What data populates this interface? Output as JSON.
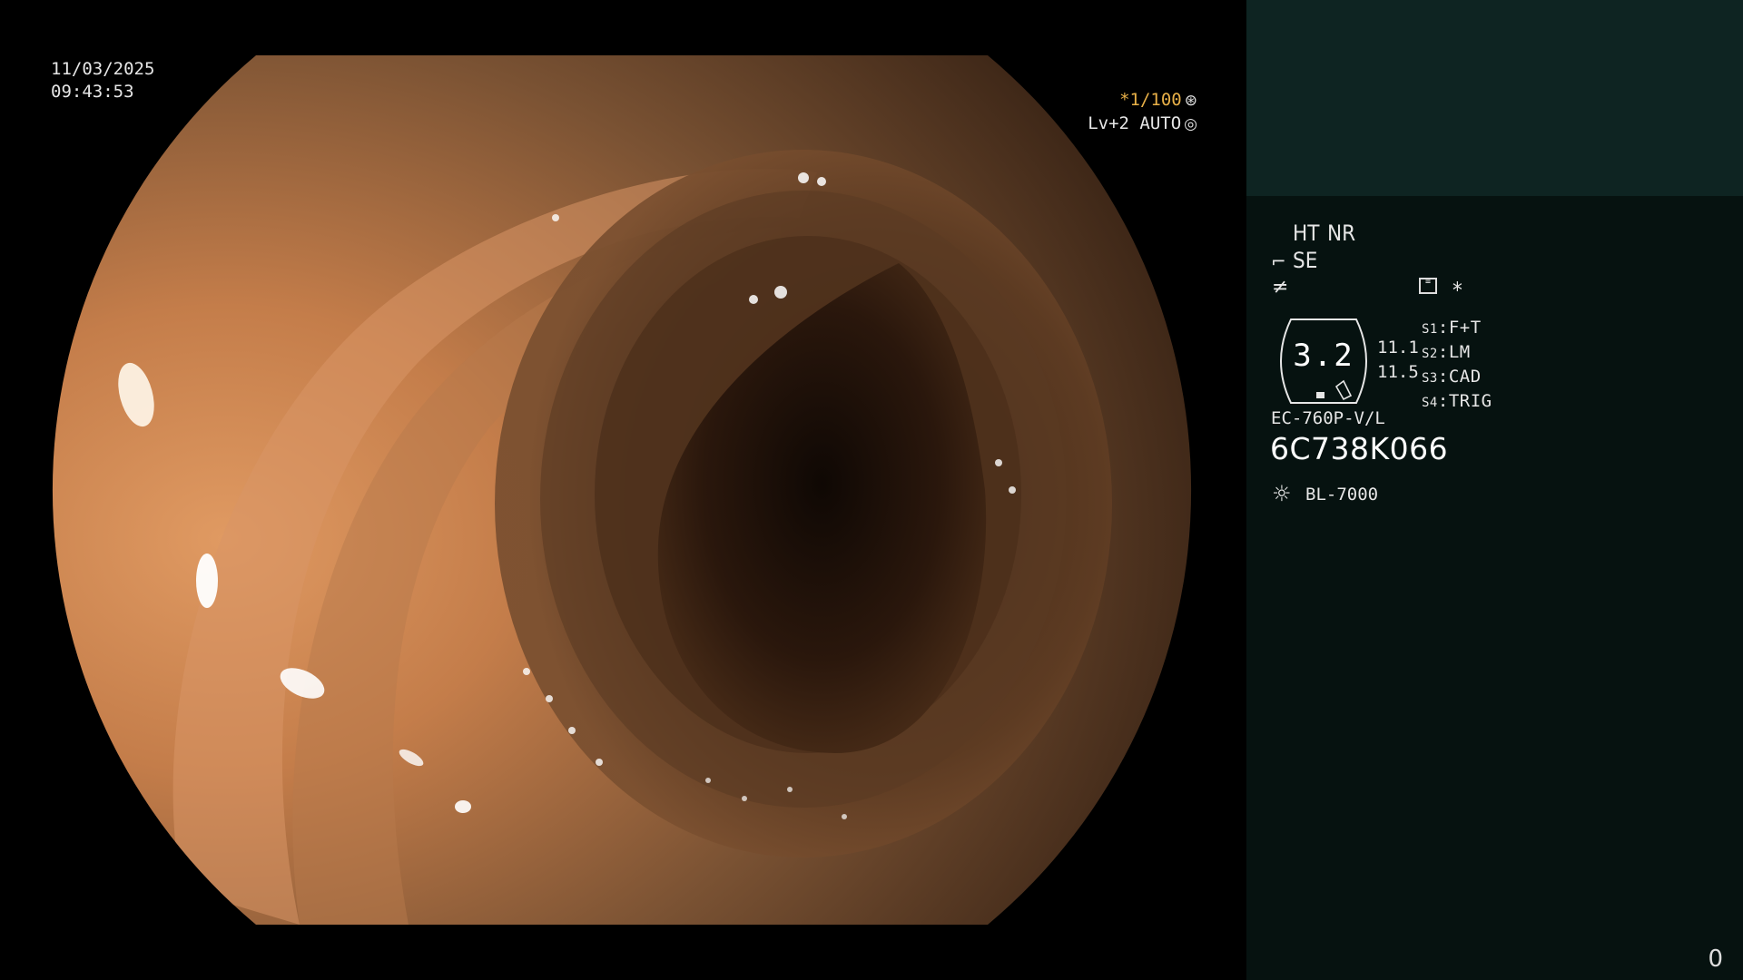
{
  "overlay": {
    "date": "11/03/2025",
    "time": "09:43:53",
    "shutter": "*1/100",
    "shutter_icon": "aperture-icon",
    "level_mode": "Lv+2 AUTO",
    "level_icon": "iris-icon"
  },
  "panel": {
    "ht_label": "HT",
    "nr_label": "NR",
    "se_label": "SE",
    "se_icon": "scope-tip-icon",
    "enhance_icon": "not-equal-icon",
    "memory_icon": "memory-card-icon",
    "asterisk": "*",
    "hex_value": "3.2",
    "hex_small_1": "11.1",
    "hex_small_2": "11.5",
    "switches": [
      {
        "key": "S1",
        "value": "F+T"
      },
      {
        "key": "S2",
        "value": "LM"
      },
      {
        "key": "S3",
        "value": "CAD"
      },
      {
        "key": "S4",
        "value": "TRIG"
      }
    ],
    "scope_model": "EC-760P-V/L",
    "serial": "6C738K066",
    "light_icon": "light-source-icon",
    "light_source": "BL-7000",
    "page_number": "0"
  },
  "colors": {
    "amber": "#e8b048",
    "panel_top": "#0e2422",
    "panel_bg": "#061210"
  }
}
